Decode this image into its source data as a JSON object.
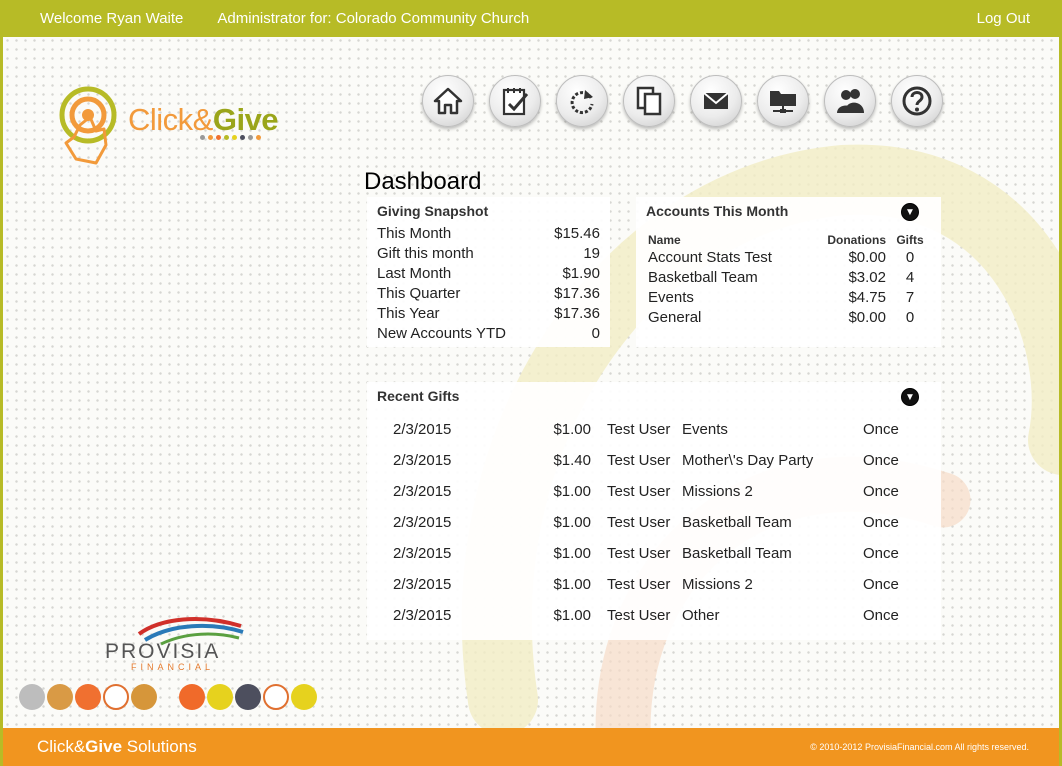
{
  "header": {
    "welcome": "Welcome Ryan Waite",
    "admin": "Administrator for: Colorado Community Church",
    "logout": "Log Out"
  },
  "logo": {
    "part1": "Click&",
    "part2": "Give"
  },
  "toolbar": {
    "icons": [
      "home-icon",
      "checklist-icon",
      "refresh-icon",
      "copy-icon",
      "mail-icon",
      "folder-network-icon",
      "users-icon",
      "help-icon"
    ]
  },
  "page": {
    "title": "Dashboard"
  },
  "snapshot": {
    "title": "Giving Snapshot",
    "rows": [
      {
        "label": "This Month",
        "value": "$15.46"
      },
      {
        "label": "Gift this month",
        "value": "19"
      },
      {
        "label": "Last Month",
        "value": "$1.90"
      },
      {
        "label": "This Quarter",
        "value": "$17.36"
      },
      {
        "label": "This Year",
        "value": "$17.36"
      },
      {
        "label": "New Accounts YTD",
        "value": "0"
      }
    ]
  },
  "accounts": {
    "title": "Accounts This Month",
    "columns": {
      "name": "Name",
      "donations": "Donations",
      "gifts": "Gifts"
    },
    "rows": [
      {
        "name": "Account Stats Test",
        "donations": "$0.00",
        "gifts": "0"
      },
      {
        "name": "Basketball Team",
        "donations": "$3.02",
        "gifts": "4"
      },
      {
        "name": "Events",
        "donations": "$4.75",
        "gifts": "7"
      },
      {
        "name": "General",
        "donations": "$0.00",
        "gifts": "0"
      }
    ]
  },
  "recent": {
    "title": "Recent Gifts",
    "rows": [
      {
        "date": "2/3/2015",
        "amount": "$1.00",
        "user": "Test User",
        "account": "Events",
        "frequency": "Once"
      },
      {
        "date": "2/3/2015",
        "amount": "$1.40",
        "user": "Test User",
        "account": "Mother\\'s Day Party",
        "frequency": "Once"
      },
      {
        "date": "2/3/2015",
        "amount": "$1.00",
        "user": "Test User",
        "account": "Missions 2",
        "frequency": "Once"
      },
      {
        "date": "2/3/2015",
        "amount": "$1.00",
        "user": "Test User",
        "account": "Basketball Team",
        "frequency": "Once"
      },
      {
        "date": "2/3/2015",
        "amount": "$1.00",
        "user": "Test User",
        "account": "Basketball Team",
        "frequency": "Once"
      },
      {
        "date": "2/3/2015",
        "amount": "$1.00",
        "user": "Test User",
        "account": "Missions 2",
        "frequency": "Once"
      },
      {
        "date": "2/3/2015",
        "amount": "$1.00",
        "user": "Test User",
        "account": "Other",
        "frequency": "Once"
      }
    ]
  },
  "provisia": {
    "name": "PROVISIA",
    "sub": "FINANCIAL"
  },
  "footer": {
    "brand_a": "Click&",
    "brand_b": "Give",
    "brand_c": " Solutions",
    "copyright": "© 2010-2012 ProvisiaFinancial.com   All rights reserved."
  },
  "colors": {
    "topbar": "#b7bb26",
    "footer": "#f1951f",
    "circles": [
      "#bdbdbd",
      "#d99a45",
      "#f07030",
      "#ffffff",
      "#d6963a",
      "#f06a2a",
      "#e6d21e",
      "#4d4f5e",
      "#ffffff",
      "#e6d21e"
    ]
  }
}
